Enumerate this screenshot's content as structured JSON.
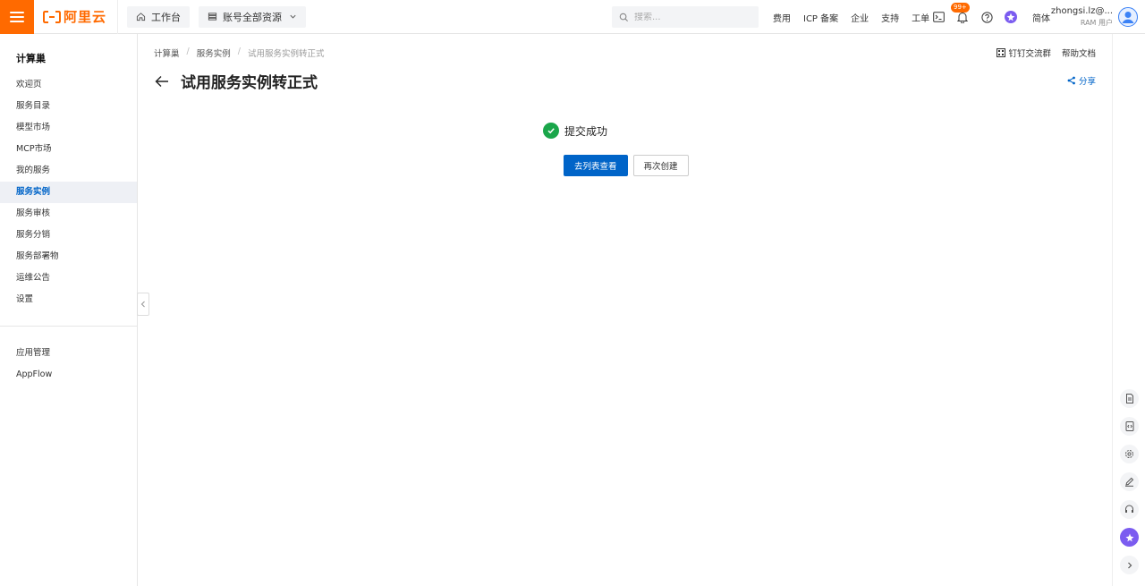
{
  "app": {
    "logo_text": "阿里云"
  },
  "topbar": {
    "workbench_label": "工作台",
    "resources_label": "账号全部资源",
    "search_placeholder": "搜索...",
    "links": [
      "费用",
      "ICP 备案",
      "企业",
      "支持",
      "工单"
    ],
    "notification_badge": "99+",
    "language": "简体",
    "user_name": "zhongsi.lz@...",
    "user_role": "RAM 用户"
  },
  "sidebar": {
    "title": "计算巢",
    "items": [
      "欢迎页",
      "服务目录",
      "模型市场",
      "MCP市场",
      "我的服务",
      "服务实例",
      "服务审核",
      "服务分销",
      "服务部署物",
      "运维公告",
      "设置"
    ],
    "active_index": 5,
    "secondary_items": [
      "应用管理",
      "AppFlow"
    ]
  },
  "breadcrumb": {
    "items": [
      "计算巢",
      "服务实例",
      "试用服务实例转正式"
    ]
  },
  "header_links": {
    "dingtalk": "钉钉交流群",
    "help": "帮助文档",
    "share": "分享"
  },
  "page": {
    "title": "试用服务实例转正式"
  },
  "result": {
    "status_text": "提交成功",
    "primary_button": "去列表查看",
    "secondary_button": "再次创建"
  },
  "colors": {
    "brand": "#ff6a00",
    "primary": "#0064c8",
    "success": "#1aa64a"
  }
}
